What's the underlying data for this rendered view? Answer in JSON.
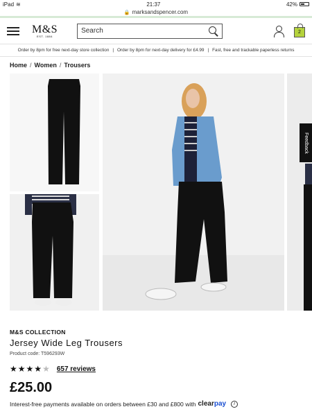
{
  "status_bar": {
    "device": "iPad",
    "time": "21:37",
    "battery": "42%"
  },
  "browser": {
    "url": "marksandspencer.com"
  },
  "header": {
    "logo": "M&S",
    "logo_sub": "EST. 1884",
    "search_placeholder": "Search",
    "bag_count": "2"
  },
  "promo": {
    "items": [
      "Order by 8pm for free next-day store collection",
      "Order by 8pm for next-day delivery for £4.99",
      "Fast, free and trackable paperless returns"
    ],
    "separator": "|"
  },
  "breadcrumb": {
    "items": [
      "Home",
      "Women",
      "Trousers"
    ],
    "separator": "/"
  },
  "feedback_label": "Feedback",
  "product": {
    "brand": "M&S COLLECTION",
    "title": "Jersey Wide Leg Trousers",
    "code": "Product code: T596293W",
    "rating": 4,
    "rating_max": 5,
    "reviews": "657 reviews",
    "price": "£25.00",
    "payment_text": "Interest-free payments available on orders between £30 and £800 with",
    "payment_provider": {
      "part1": "clear",
      "part2": "pay"
    }
  },
  "colors": {
    "bag": "#b5d33d",
    "url_accent": "#d7ead6",
    "clearpay": "#1a4fd1"
  }
}
